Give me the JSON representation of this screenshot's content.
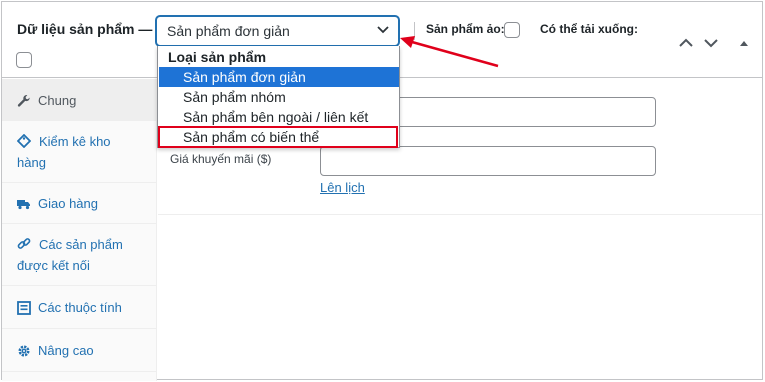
{
  "header": {
    "title": "Dữ liệu sản phẩm —",
    "product_type_value": "Sản phẩm đơn giản",
    "virtual_label": "Sản phẩm ảo:",
    "downloadable_label": "Có thể tải xuống:"
  },
  "dropdown": {
    "group_label": "Loại sản phẩm",
    "options": [
      {
        "label": "Sản phẩm đơn giản",
        "selected": true
      },
      {
        "label": "Sản phẩm nhóm",
        "selected": false
      },
      {
        "label": "Sản phẩm bên ngoài / liên kết",
        "selected": false
      },
      {
        "label": "Sản phẩm có biến thể",
        "selected": false,
        "highlighted": true
      }
    ]
  },
  "sidebar": {
    "items": [
      {
        "label": "Chung",
        "icon": "wrench-icon",
        "active": true
      },
      {
        "label": "Kiểm kê kho hàng",
        "icon": "tag-icon",
        "active": false
      },
      {
        "label": "Giao hàng",
        "icon": "truck-icon",
        "active": false
      },
      {
        "label": "Các sản phẩm được kết nối",
        "icon": "link-icon",
        "active": false
      },
      {
        "label": "Các thuộc tính",
        "icon": "list-icon",
        "active": false
      },
      {
        "label": "Nâng cao",
        "icon": "gear-icon",
        "active": false
      }
    ]
  },
  "general": {
    "sale_price_label": "Giá khuyến mãi ($)",
    "schedule_link": "Lên lịch"
  },
  "colors": {
    "accent": "#2271b1",
    "selected_option": "#1e73d6",
    "annotation": "#e0001b"
  }
}
